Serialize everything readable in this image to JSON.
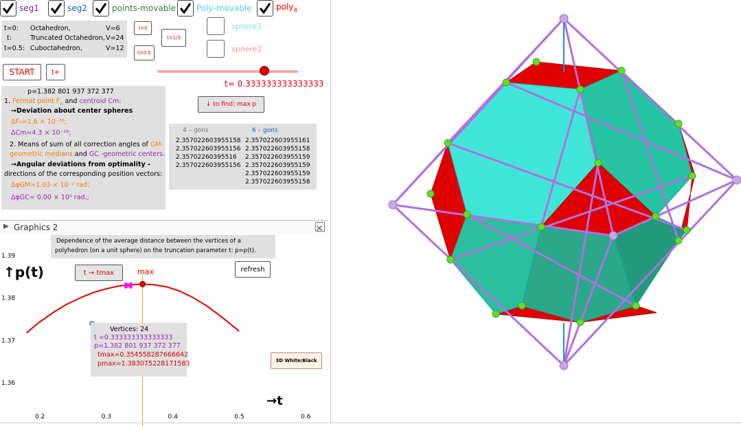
{
  "colors": {
    "red": "#e00000",
    "purple": "#9c27b0",
    "green": "#2e7d32",
    "cyan": "#4dd0e1",
    "blue": "#1565c0",
    "orange": "#f57c00",
    "panel": "#e0e0e0"
  },
  "checkboxes": [
    {
      "label": "seg1",
      "checked": true,
      "color": "#7b1fa2"
    },
    {
      "label": "seg2",
      "checked": true,
      "color": "#1565c0"
    },
    {
      "label": "points-movable",
      "checked": true,
      "color": "#2e7d32"
    },
    {
      "label": "Poly-movable",
      "checked": true,
      "color": "#4dd0e1"
    },
    {
      "label": "poly",
      "sub": "4",
      "checked": true,
      "color": "#e00000"
    }
  ],
  "spheres": [
    {
      "label": "sphere1",
      "checked": false
    },
    {
      "label": "sphere2",
      "checked": false
    }
  ],
  "info": {
    "rows": [
      {
        "t": "t=0:",
        "name": "Octahedron,",
        "v": "V=6"
      },
      {
        "t": "t:",
        "name": "Truncated Octahedron,",
        "v": "V=24"
      },
      {
        "t": "t=0.5:",
        "name": "Cuboctahedron,",
        "v": "V=12"
      }
    ]
  },
  "buttons": {
    "t0": "t=0",
    "t13": "t=1/3",
    "t05": "t=0.5",
    "start": "START",
    "tplus": "t+",
    "find": "↓ to find: max p",
    "tmax": "t → tmax",
    "refresh": "refresh",
    "white_black": "3D White/Black"
  },
  "slider": {
    "value_label": "t= 0.333333333333333",
    "fraction": 0.76
  },
  "results": {
    "p_line": "p=1.382 801 937 372 377",
    "l1_num": "1.",
    "l1_fermat": "Fermat point F",
    "l1_sub": "o",
    "l1_and": "and",
    "l1_centroid": "centroid Cm:",
    "l2": "→Deviation about center spheres",
    "l3": "ΔF₀=1.6 × 10⁻¹⁶;",
    "l4": "ΔCm=4.3 × 10⁻¹⁶;",
    "l5a": "2. Means of sum of all correction angles of",
    "l5b": "GM-",
    "l6a": "geometric medians",
    "l6b": "and",
    "l6c": "GC -geometric centers.",
    "l7": "→Angular deviations from optimality -",
    "l8": "directions of the corresponding position vectors:",
    "l9": "ΔφGM=1.03 × 10⁻² rad;",
    "l10": "ΔφGC= 0.00 × 10⁰ rad.;"
  },
  "gons": {
    "h4": "4 – gons",
    "h6": "6 – gons",
    "col4": [
      "2.357022603955158",
      "2.357022603955156",
      "2.35702260395516",
      "2.357022603955156"
    ],
    "col6": [
      "2.357022603955161",
      "2.357022603955158",
      "2.357022603955159",
      "2.357022603955159",
      "2.357022603955159",
      "2.357022603955158"
    ]
  },
  "graphics2": {
    "title": "Graphics 2",
    "caption1": "Dependence of the average distance between the vertices of a",
    "caption2": "polyhedron (on a unit sphere) on the truncation parameter t: p=p(t).",
    "ylabel": "↑p(t)",
    "xlabel": "→t",
    "max_label": "max",
    "vertices": "Vertices: 24",
    "t_line": "t =0.333333333333333",
    "p_line": "p=1.382 801 937 372 377",
    "tmax_line": "tmax=0.354558287666642",
    "pmax_line": "pmax=1.383075228171583"
  },
  "chart_data": {
    "type": "line",
    "title": "",
    "xlabel": "t",
    "ylabel": "p(t)",
    "xlim": [
      0.15,
      0.65
    ],
    "ylim": [
      1.355,
      1.395
    ],
    "xticks": [
      0.2,
      0.3,
      0.4,
      0.5,
      0.6
    ],
    "yticks": [
      1.36,
      1.37,
      1.38,
      1.39
    ],
    "series": [
      {
        "x": [
          0.18,
          0.2,
          0.22,
          0.24,
          0.26,
          0.28,
          0.3,
          0.32,
          0.34,
          0.355,
          0.37,
          0.39,
          0.41,
          0.43,
          0.45,
          0.47,
          0.49,
          0.5
        ],
        "y": [
          1.3716,
          1.3742,
          1.3764,
          1.3783,
          1.3798,
          1.3811,
          1.382,
          1.3827,
          1.383,
          1.3831,
          1.383,
          1.3825,
          1.3815,
          1.38,
          1.3781,
          1.3758,
          1.3733,
          1.372
        ]
      }
    ],
    "current_point": {
      "x": 0.3333,
      "y": 1.3828
    },
    "max_point": {
      "x": 0.3546,
      "y": 1.3831
    }
  }
}
